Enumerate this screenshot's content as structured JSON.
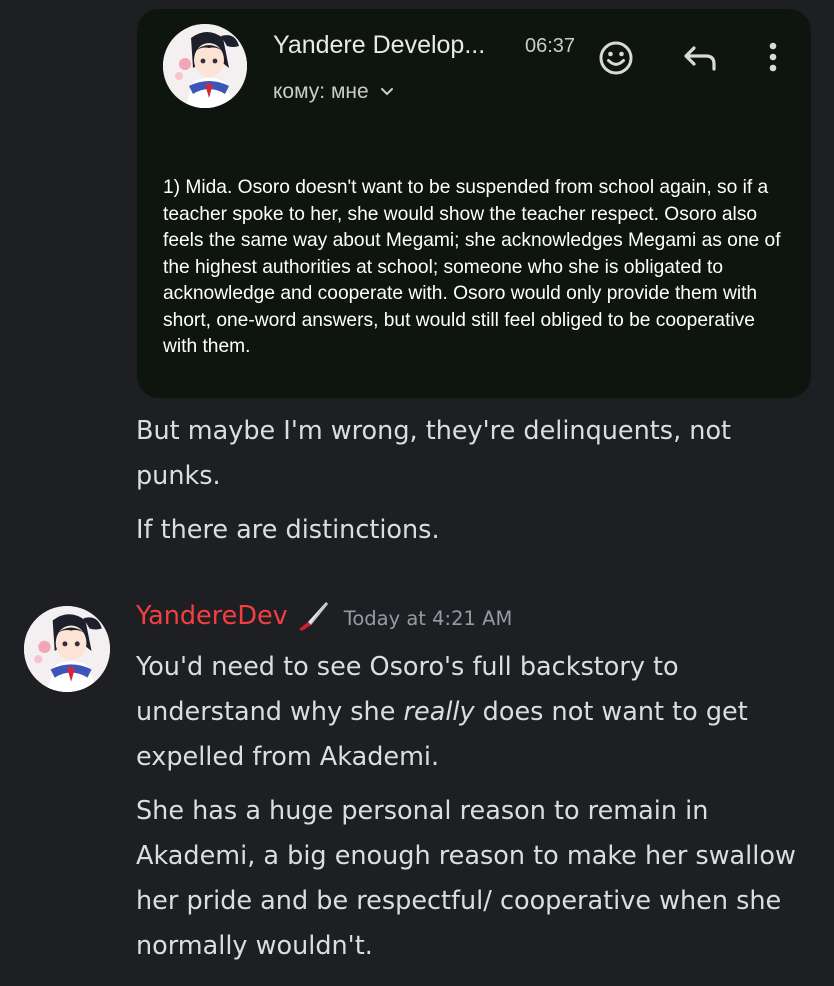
{
  "email": {
    "sender": "Yandere Develop...",
    "time": "06:37",
    "recipient": "кому: мне",
    "body": "1) Mida. Osoro doesn't want to be suspended from school again, so if a teacher spoke to her, she would show the teacher respect. Osoro also feels the same way about Megami; she acknowledges Megami as one of the highest authorities at school; someone who she is obligated to acknowledge and cooperate with. Osoro would only provide them with short, one-word answers, but would still feel obliged to be cooperative with them.",
    "icons": [
      "emoji-icon",
      "reply-icon",
      "more-vert-icon",
      "chevron-down-icon"
    ]
  },
  "prev_messages": [
    "But maybe I'm wrong, they're delinquents, not punks.",
    "If there are distinctions."
  ],
  "message": {
    "author": "YandereDev",
    "author_color": "#f23f43",
    "role_icon": "knife-icon",
    "timestamp": "Today at 4:21 AM",
    "line1_before": "You'd need to see Osoro's full backstory to understand why she ",
    "line1_emphasis": "really",
    "line1_after": " does not want to get expelled from Akademi.",
    "line2": "She has a huge personal reason to remain in Akademi, a big enough reason to make her swallow her pride and be respectful/ cooperative when she normally wouldn't."
  }
}
